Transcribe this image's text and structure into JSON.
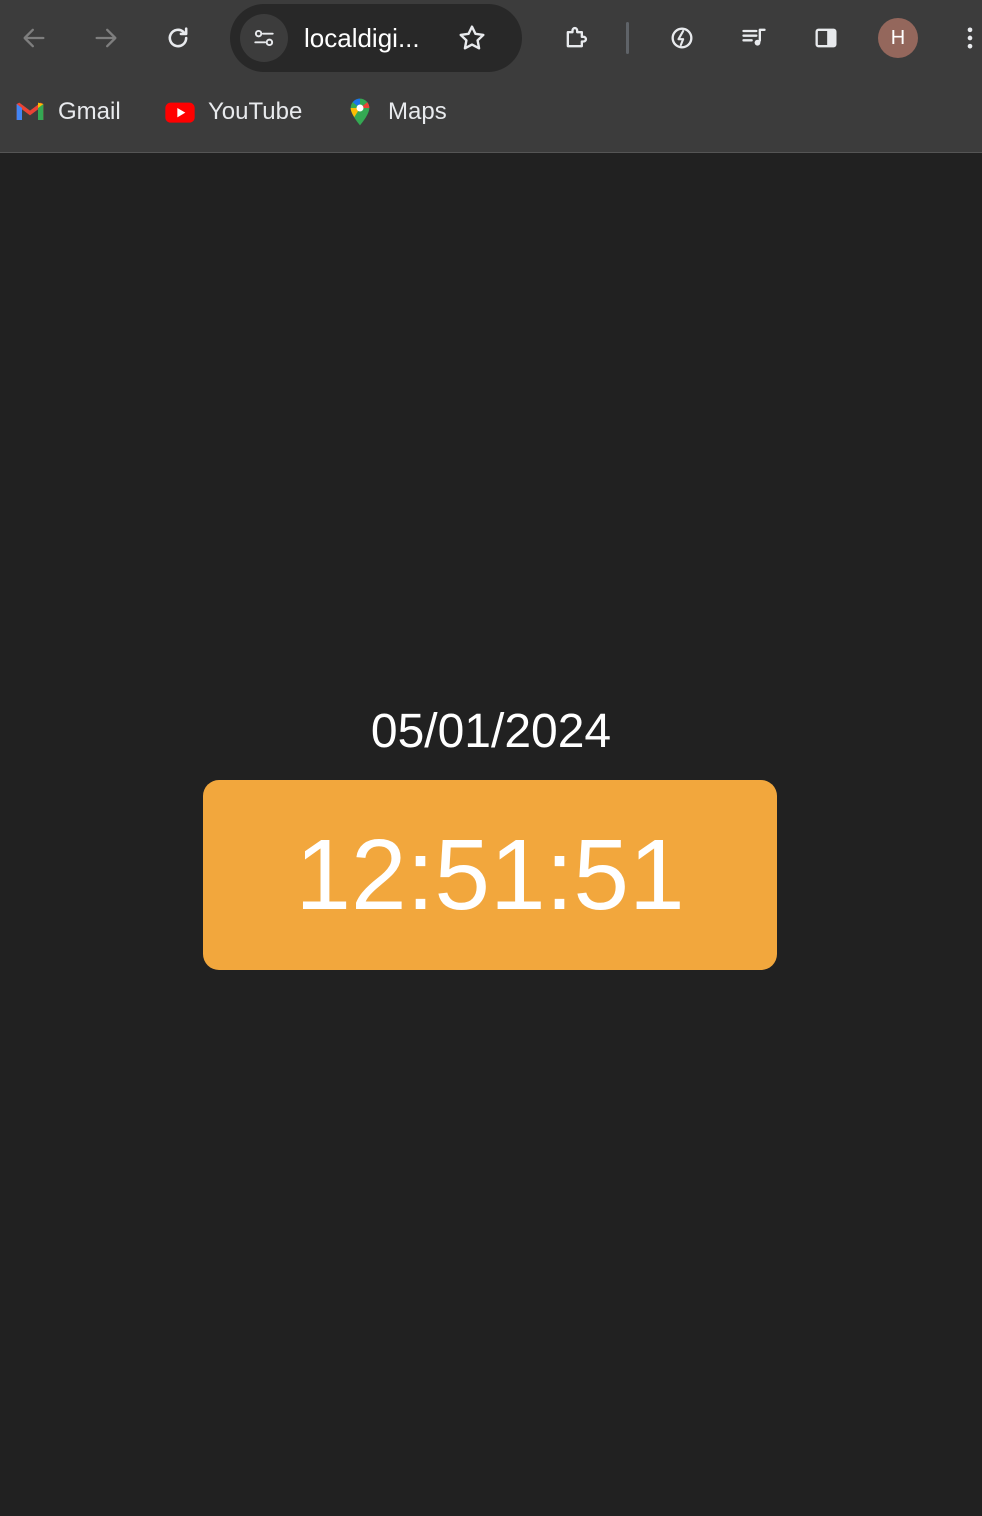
{
  "browser": {
    "url_display": "localdigi...",
    "profile_initial": "H",
    "bookmarks": [
      {
        "label": "Gmail",
        "icon": "gmail-icon"
      },
      {
        "label": "YouTube",
        "icon": "youtube-icon"
      },
      {
        "label": "Maps",
        "icon": "maps-icon"
      }
    ]
  },
  "page": {
    "date": "05/01/2024",
    "time": "12:51:51"
  },
  "colors": {
    "background": "#212121",
    "clock_background": "#f2a73d",
    "text": "#ffffff"
  }
}
